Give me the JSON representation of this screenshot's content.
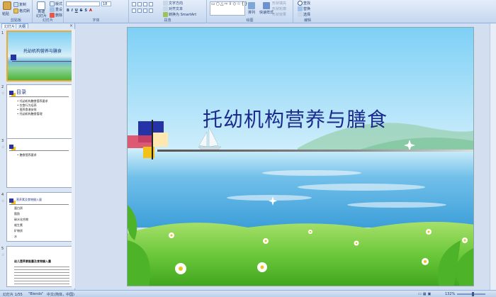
{
  "ribbon": {
    "groups": {
      "clipboard": "剪贴板",
      "slides": "幻灯片",
      "font": "字体",
      "paragraph": "段落",
      "drawing": "绘图",
      "editing": "编辑"
    },
    "clipboard": {
      "paste": "粘贴",
      "copy": "复制",
      "format_painter": "格式刷"
    },
    "slides": {
      "new_slide": "新建",
      "new_slide_line2": "幻灯片",
      "layout": "版式",
      "reset": "重设",
      "delete": "删除"
    },
    "font": {
      "size": "18"
    },
    "paragraph": {
      "text_direction": "文字方向",
      "align_text": "对齐文本",
      "convert_smartart": "转换为 SmartArt"
    },
    "drawing": {
      "arrange": "排列",
      "quick_styles": "快速样式",
      "shape_fill": "形状填充",
      "shape_outline": "形状轮廓",
      "shape_effects": "形状效果"
    },
    "editing": {
      "find": "查找",
      "replace": "替换",
      "select": "选择"
    }
  },
  "panel": {
    "tab_slides": "幻灯片",
    "tab_outline": "大纲",
    "close": "×",
    "thumbs": [
      {
        "num": "1",
        "title": "托幼机构营养与膳食"
      },
      {
        "num": "2",
        "heading": "目录",
        "items": [
          "托幼机构膳食营养要求",
          "饮食行为培养",
          "营养食谱安排",
          "托幼机构膳食管理"
        ]
      },
      {
        "num": "3",
        "items": [
          "膳食营养要求"
        ]
      },
      {
        "num": "4",
        "heading": "营养素及食物摄入量",
        "items": [
          "蛋白质",
          "脂肪",
          "碳水化合物",
          "维生素",
          "矿物质",
          "水"
        ]
      },
      {
        "num": "5",
        "heading": "幼儿营养素能量及食物摄入量"
      }
    ]
  },
  "slide": {
    "title": "托幼机构营养与膳食"
  },
  "status": {
    "slide_count": "幻灯片 1/55",
    "theme": "\"Blends\"",
    "language": "中文(简体，中国)",
    "zoom": "132%"
  }
}
